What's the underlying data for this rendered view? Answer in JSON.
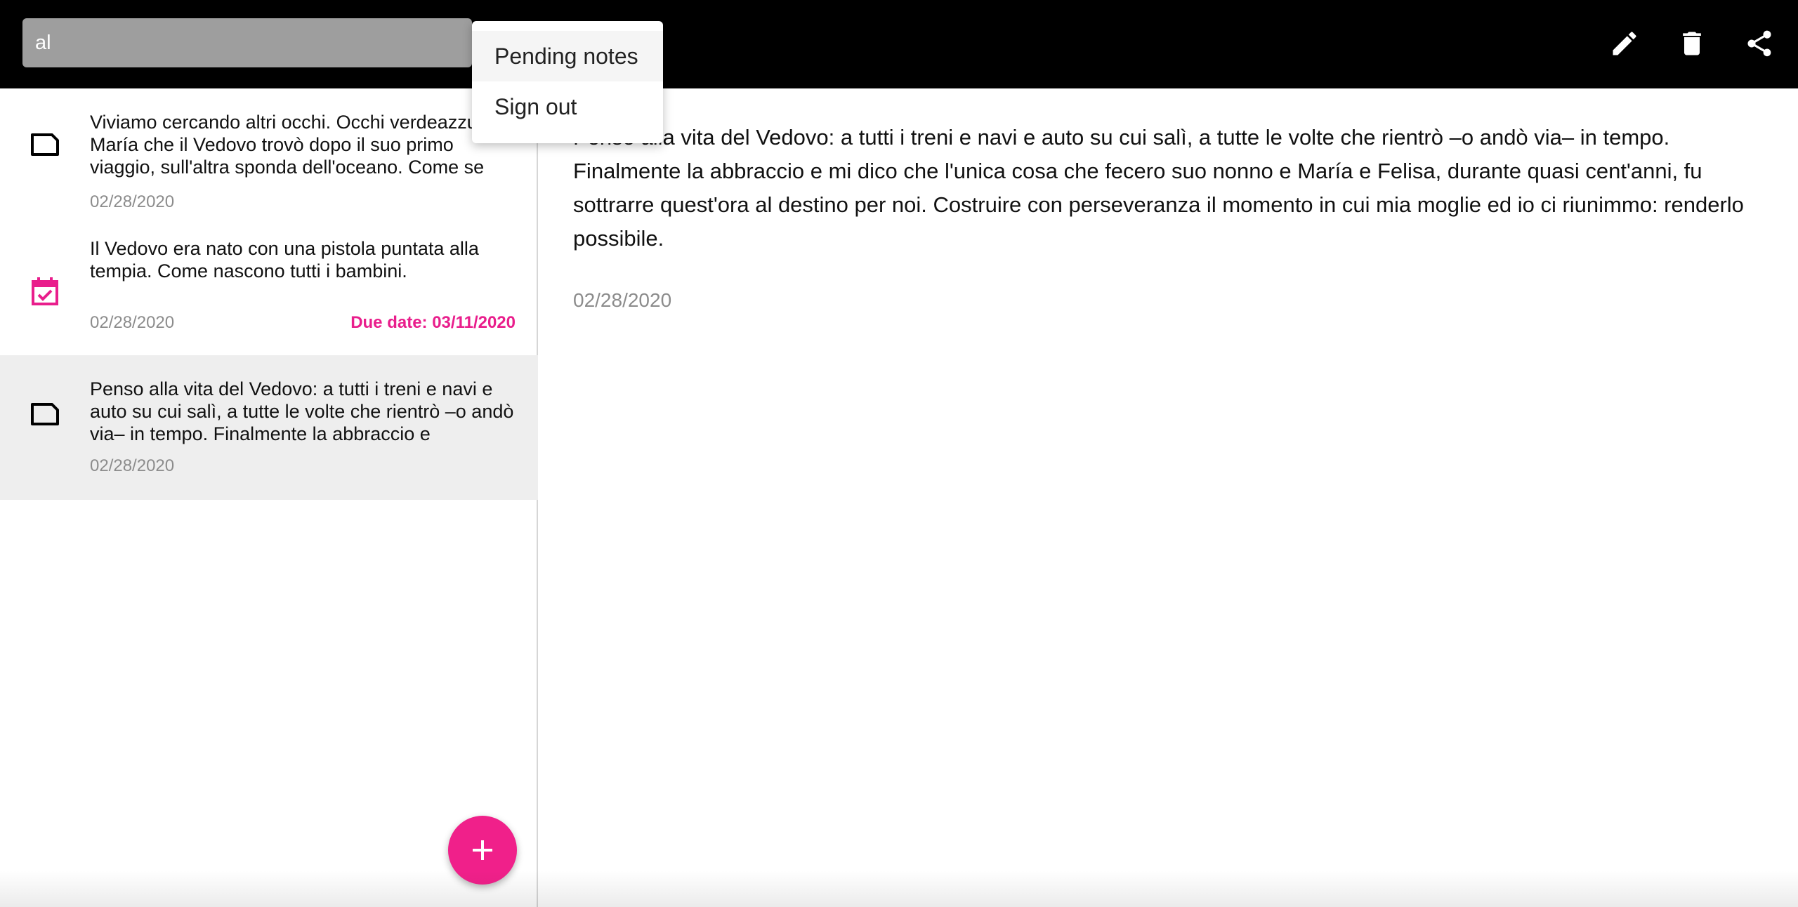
{
  "search": {
    "value": "al"
  },
  "menu": {
    "items": [
      "Pending notes",
      "Sign out"
    ]
  },
  "toolbar": {
    "icons": [
      "pencil-icon",
      "trash-icon",
      "share-icon"
    ]
  },
  "notes": [
    {
      "icon": "note-icon",
      "text": "Viviamo cercando altri occhi. Occhi verdeazzurri di María che il Vedovo trovò dopo il suo primo viaggio, sull'altra sponda dell'oceano. Come se",
      "date": "02/28/2020"
    },
    {
      "icon": "calendar-check-icon",
      "text": "Il Vedovo era nato con una pistola puntata alla tempia. Come nascono tutti i bambini.",
      "date": "02/28/2020",
      "due": "Due date: 03/11/2020"
    },
    {
      "icon": "note-icon",
      "text": "Penso alla vita del Vedovo: a tutti i treni e navi e auto su cui salì, a tutte le volte che rientrò –o andò via– in tempo. Finalmente la abbraccio e",
      "date": "02/28/2020"
    }
  ],
  "detail": {
    "text": "Penso alla vita del Vedovo: a tutti i treni e navi e auto su cui salì, a tutte le volte che rientrò –o andò via– in tempo. Finalmente la abbraccio e mi dico che l'unica cosa che fecero suo nonno e María e Felisa, durante quasi cent'anni, fu sottrarre quest'ora al destino per noi. Costruire con perseveranza il momento in cui mia moglie ed io ci riunimmo: renderlo possibile.",
    "date": "02/28/2020"
  },
  "colors": {
    "accent": "#f0208a",
    "topbar": "#000000",
    "selected_row": "#eeeeee"
  }
}
